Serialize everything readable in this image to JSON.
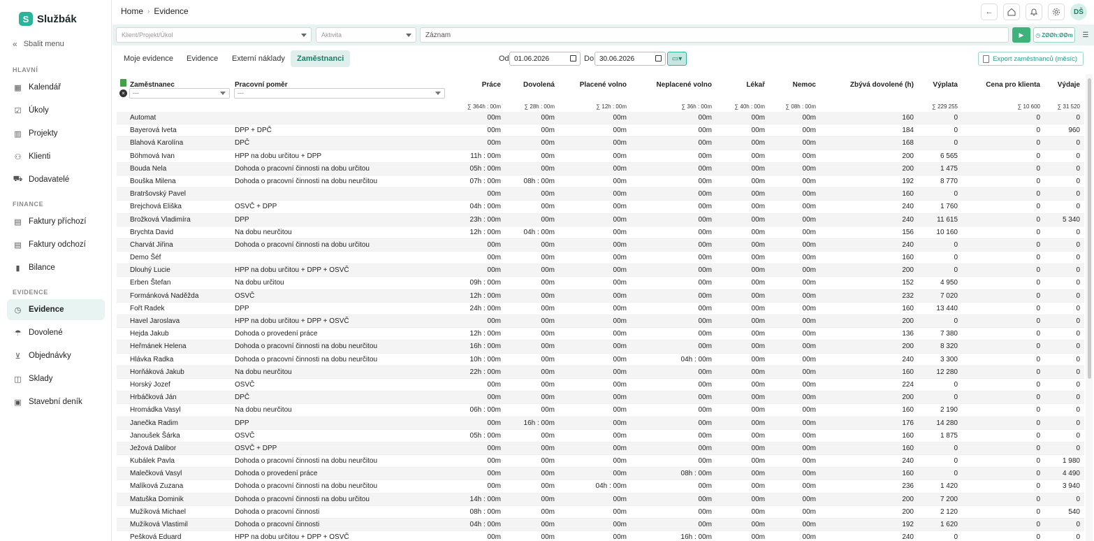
{
  "app": {
    "logo_letter": "S",
    "logo_text": "Službák"
  },
  "sidebar": {
    "collapse_label": "Sbalit menu",
    "sections": [
      {
        "label": "HLAVNÍ",
        "items": [
          {
            "label": "Kalendář",
            "icon": "calendar-icon"
          },
          {
            "label": "Úkoly",
            "icon": "checkbox-icon"
          },
          {
            "label": "Projekty",
            "icon": "kanban-icon"
          },
          {
            "label": "Klienti",
            "icon": "users-icon"
          },
          {
            "label": "Dodavatelé",
            "icon": "truck-icon"
          }
        ]
      },
      {
        "label": "FINANCE",
        "items": [
          {
            "label": "Faktury příchozí",
            "icon": "invoice-in-icon"
          },
          {
            "label": "Faktury odchozí",
            "icon": "invoice-out-icon"
          },
          {
            "label": "Bilance",
            "icon": "bar-chart-icon"
          }
        ]
      },
      {
        "label": "EVIDENCE",
        "items": [
          {
            "label": "Evidence",
            "icon": "clock-icon",
            "active": true
          },
          {
            "label": "Dovolené",
            "icon": "umbrella-icon"
          },
          {
            "label": "Objednávky",
            "icon": "cart-icon"
          },
          {
            "label": "Sklady",
            "icon": "box-icon"
          },
          {
            "label": "Stavební deník",
            "icon": "journal-icon"
          }
        ]
      }
    ]
  },
  "header": {
    "breadcrumb": [
      "Home",
      "Evidence"
    ],
    "icons": [
      "back-icon",
      "home-icon",
      "bell-icon",
      "gear-icon"
    ],
    "avatar_initials": "DŠ"
  },
  "tracker": {
    "project_placeholder": "Klient/Projekt/Úkol",
    "activity_placeholder": "Aktivita",
    "record_placeholder": "Záznam",
    "timer": "ZØØh:ØØm"
  },
  "tabs": [
    {
      "label": "Moje evidence",
      "active": false
    },
    {
      "label": "Evidence",
      "active": false
    },
    {
      "label": "Externí náklady",
      "active": false
    },
    {
      "label": "Zaměstnanci",
      "active": true
    }
  ],
  "date_filter": {
    "from_label": "Od",
    "from": "01.06.2026",
    "to_label": "Do",
    "to": "30.06.2026"
  },
  "export_label": "Export zaměstnanců (měsíc)",
  "table": {
    "columns": [
      {
        "key": "name",
        "label": "Zaměstnanec"
      },
      {
        "key": "contract",
        "label": "Pracovní poměr"
      },
      {
        "key": "work",
        "label": "Práce",
        "sum": "∑ 364h : 00m"
      },
      {
        "key": "vacation",
        "label": "Dovolená",
        "sum": "∑ 28h : 00m"
      },
      {
        "key": "paid",
        "label": "Placené volno",
        "sum": "∑ 12h : 00m"
      },
      {
        "key": "unpaid",
        "label": "Neplacené volno",
        "sum": "∑ 36h : 00m"
      },
      {
        "key": "doctor",
        "label": "Lékař",
        "sum": "∑ 40h : 00m"
      },
      {
        "key": "sick",
        "label": "Nemoc",
        "sum": "∑ 08h : 00m"
      },
      {
        "key": "remaining",
        "label": "Zbývá dovolené (h)",
        "sum": ""
      },
      {
        "key": "pay",
        "label": "Výplata",
        "sum": "∑ 229 255"
      },
      {
        "key": "client_price",
        "label": "Cena pro klienta",
        "sum": "∑ 10 600"
      },
      {
        "key": "expenses",
        "label": "Výdaje",
        "sum": "∑ 31 520"
      }
    ],
    "filter_placeholder": "---",
    "rows": [
      [
        "Automat",
        "",
        "00m",
        "00m",
        "00m",
        "00m",
        "00m",
        "00m",
        "160",
        "0",
        "0",
        "0"
      ],
      [
        "Bayerová Iveta",
        "DPP + DPČ",
        "00m",
        "00m",
        "00m",
        "00m",
        "00m",
        "00m",
        "184",
        "0",
        "0",
        "960"
      ],
      [
        "Blahová Karolína",
        "DPČ",
        "00m",
        "00m",
        "00m",
        "00m",
        "00m",
        "00m",
        "168",
        "0",
        "0",
        "0"
      ],
      [
        "Böhmová Ivan",
        "HPP na dobu určitou + DPP",
        "11h : 00m",
        "00m",
        "00m",
        "00m",
        "00m",
        "00m",
        "200",
        "6 565",
        "0",
        "0"
      ],
      [
        "Bouda Nela",
        "Dohoda o pracovní činnosti na dobu určitou",
        "05h : 00m",
        "00m",
        "00m",
        "00m",
        "00m",
        "00m",
        "200",
        "1 475",
        "0",
        "0"
      ],
      [
        "Bouška Milena",
        "Dohoda o pracovní činnosti na dobu neurčitou",
        "07h : 00m",
        "08h : 00m",
        "00m",
        "00m",
        "00m",
        "00m",
        "192",
        "8 770",
        "0",
        "0"
      ],
      [
        "Bratršovský Pavel",
        "",
        "00m",
        "00m",
        "00m",
        "00m",
        "00m",
        "00m",
        "160",
        "0",
        "0",
        "0"
      ],
      [
        "Brejchová Eliška",
        "OSVČ + DPP",
        "04h : 00m",
        "00m",
        "00m",
        "00m",
        "00m",
        "00m",
        "240",
        "1 760",
        "0",
        "0"
      ],
      [
        "Brožková Vladimíra",
        "DPP",
        "23h : 00m",
        "00m",
        "00m",
        "00m",
        "00m",
        "00m",
        "240",
        "11 615",
        "0",
        "5 340"
      ],
      [
        "Brychta David",
        "Na dobu neurčitou",
        "12h : 00m",
        "04h : 00m",
        "00m",
        "00m",
        "00m",
        "00m",
        "156",
        "10 160",
        "0",
        "0"
      ],
      [
        "Charvát Jiřina",
        "Dohoda o pracovní činnosti na dobu určitou",
        "00m",
        "00m",
        "00m",
        "00m",
        "00m",
        "00m",
        "240",
        "0",
        "0",
        "0"
      ],
      [
        "Demo Šéf",
        "",
        "00m",
        "00m",
        "00m",
        "00m",
        "00m",
        "00m",
        "160",
        "0",
        "0",
        "0"
      ],
      [
        "Dlouhý Lucie",
        "HPP na dobu určitou + DPP + OSVČ",
        "00m",
        "00m",
        "00m",
        "00m",
        "00m",
        "00m",
        "200",
        "0",
        "0",
        "0"
      ],
      [
        "Erben Štefan",
        "Na dobu určitou",
        "09h : 00m",
        "00m",
        "00m",
        "00m",
        "00m",
        "00m",
        "152",
        "4 950",
        "0",
        "0"
      ],
      [
        "Formánková Naděžda",
        "OSVČ",
        "12h : 00m",
        "00m",
        "00m",
        "00m",
        "00m",
        "00m",
        "232",
        "7 020",
        "0",
        "0"
      ],
      [
        "Fořt Radek",
        "DPP",
        "24h : 00m",
        "00m",
        "00m",
        "00m",
        "00m",
        "00m",
        "160",
        "13 440",
        "0",
        "0"
      ],
      [
        "Havel Jaroslava",
        "HPP na dobu určitou + DPP + OSVČ",
        "00m",
        "00m",
        "00m",
        "00m",
        "00m",
        "00m",
        "200",
        "0",
        "0",
        "0"
      ],
      [
        "Hejda Jakub",
        "Dohoda o provedení práce",
        "12h : 00m",
        "00m",
        "00m",
        "00m",
        "00m",
        "00m",
        "136",
        "7 380",
        "0",
        "0"
      ],
      [
        "Heřmánek Helena",
        "Dohoda o pracovní činnosti na dobu neurčitou",
        "16h : 00m",
        "00m",
        "00m",
        "00m",
        "00m",
        "00m",
        "200",
        "8 320",
        "0",
        "0"
      ],
      [
        "Hlávka Radka",
        "Dohoda o pracovní činnosti na dobu neurčitou",
        "10h : 00m",
        "00m",
        "00m",
        "04h : 00m",
        "00m",
        "00m",
        "240",
        "3 300",
        "0",
        "0"
      ],
      [
        "Horňáková Jakub",
        "Na dobu neurčitou",
        "22h : 00m",
        "00m",
        "00m",
        "00m",
        "00m",
        "00m",
        "160",
        "12 280",
        "0",
        "0"
      ],
      [
        "Horský Jozef",
        "OSVČ",
        "00m",
        "00m",
        "00m",
        "00m",
        "00m",
        "00m",
        "224",
        "0",
        "0",
        "0"
      ],
      [
        "Hrbáčková Ján",
        "DPČ",
        "00m",
        "00m",
        "00m",
        "00m",
        "00m",
        "00m",
        "200",
        "0",
        "0",
        "0"
      ],
      [
        "Hromádka Vasyl",
        "Na dobu neurčitou",
        "06h : 00m",
        "00m",
        "00m",
        "00m",
        "00m",
        "00m",
        "160",
        "2 190",
        "0",
        "0"
      ],
      [
        "Janečka Radim",
        "DPP",
        "00m",
        "16h : 00m",
        "00m",
        "00m",
        "00m",
        "00m",
        "176",
        "14 280",
        "0",
        "0"
      ],
      [
        "Janoušek Šárka",
        "OSVČ",
        "05h : 00m",
        "00m",
        "00m",
        "00m",
        "00m",
        "00m",
        "160",
        "1 875",
        "0",
        "0"
      ],
      [
        "Ježová Dalibor",
        "OSVČ + DPP",
        "00m",
        "00m",
        "00m",
        "00m",
        "00m",
        "00m",
        "160",
        "0",
        "0",
        "0"
      ],
      [
        "Kubálek Pavla",
        "Dohoda o pracovní činnosti na dobu neurčitou",
        "00m",
        "00m",
        "00m",
        "00m",
        "00m",
        "00m",
        "240",
        "0",
        "0",
        "1 980"
      ],
      [
        "Malečková Vasyl",
        "Dohoda o provedení práce",
        "00m",
        "00m",
        "00m",
        "08h : 00m",
        "00m",
        "00m",
        "160",
        "0",
        "0",
        "4 490"
      ],
      [
        "Malíková Zuzana",
        "Dohoda o pracovní činnosti na dobu neurčitou",
        "00m",
        "00m",
        "04h : 00m",
        "00m",
        "00m",
        "00m",
        "236",
        "1 420",
        "0",
        "3 940"
      ],
      [
        "Matuška Dominik",
        "Dohoda o pracovní činnosti na dobu určitou",
        "14h : 00m",
        "00m",
        "00m",
        "00m",
        "00m",
        "00m",
        "200",
        "7 200",
        "0",
        "0"
      ],
      [
        "Mužíková Michael",
        "Dohoda o pracovní činnosti",
        "08h : 00m",
        "00m",
        "00m",
        "00m",
        "00m",
        "00m",
        "200",
        "2 120",
        "0",
        "540"
      ],
      [
        "Mužíková Vlastimil",
        "Dohoda o pracovní činnosti",
        "04h : 00m",
        "00m",
        "00m",
        "00m",
        "00m",
        "00m",
        "192",
        "1 620",
        "0",
        "0"
      ],
      [
        "Pešková Eduard",
        "HPP na dobu určitou + DPP + OSVČ",
        "00m",
        "00m",
        "00m",
        "16h : 00m",
        "00m",
        "00m",
        "240",
        "0",
        "0",
        "0"
      ]
    ]
  }
}
